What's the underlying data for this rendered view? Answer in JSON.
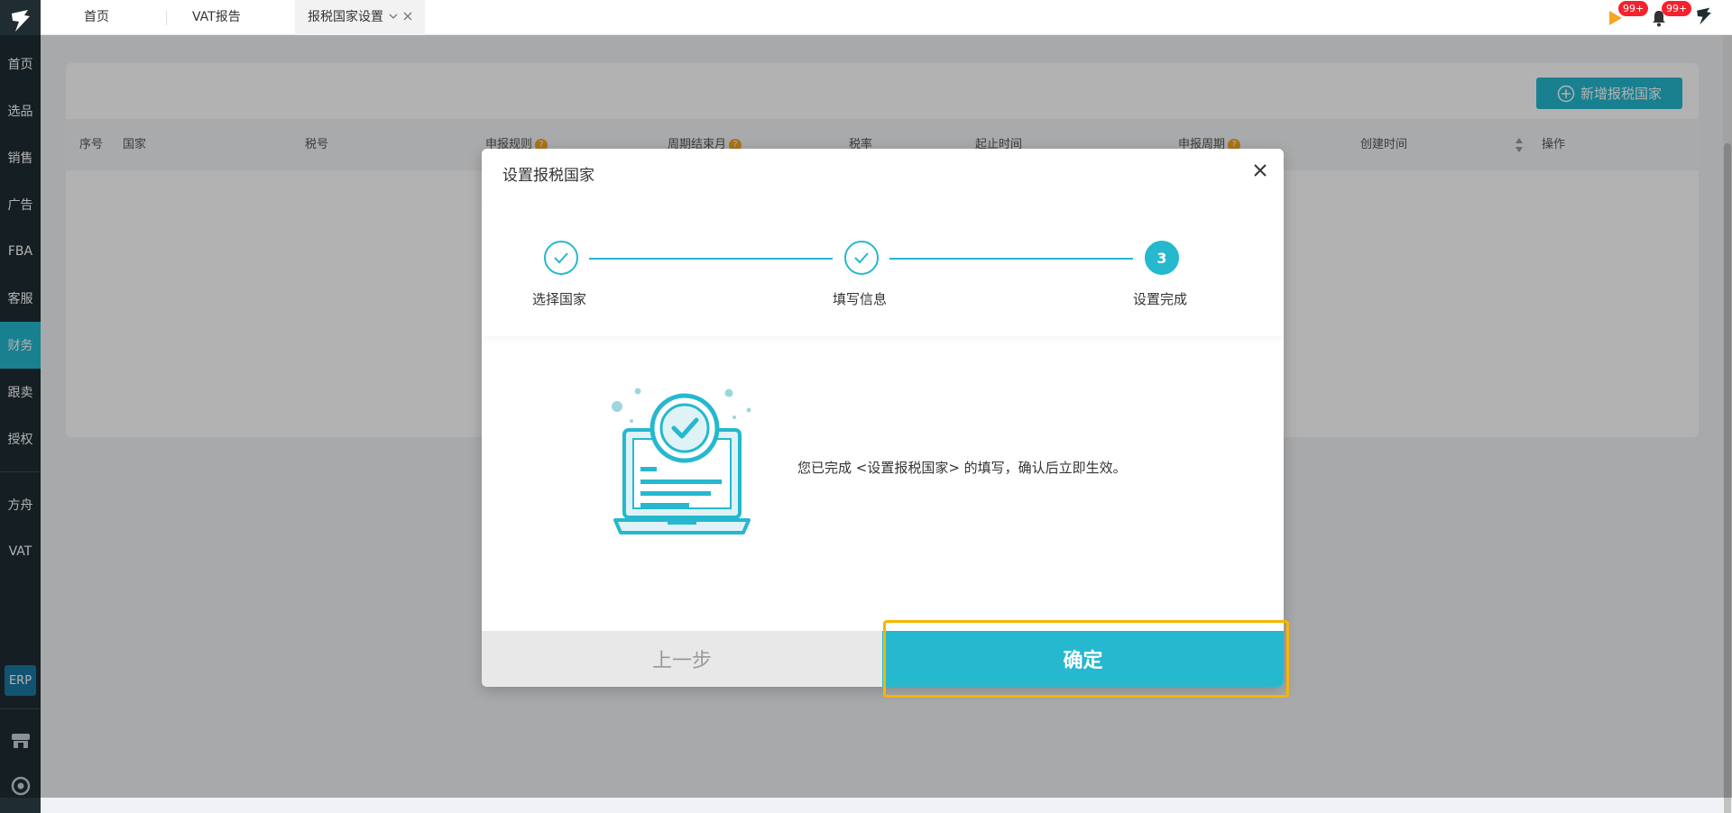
{
  "sidebar": {
    "items": [
      {
        "label": "首页"
      },
      {
        "label": "选品"
      },
      {
        "label": "销售"
      },
      {
        "label": "广告"
      },
      {
        "label": "FBA"
      },
      {
        "label": "客服"
      },
      {
        "label": "财务"
      },
      {
        "label": "跟卖"
      },
      {
        "label": "授权"
      }
    ],
    "items2": [
      {
        "label": "方舟"
      },
      {
        "label": "VAT"
      }
    ],
    "erp_label": "ERP"
  },
  "tabs": [
    {
      "label": "首页"
    },
    {
      "label": "VAT报告"
    },
    {
      "label": "报税国家设置"
    }
  ],
  "header": {
    "badge1": "99+",
    "badge2": "99+"
  },
  "page": {
    "add_button_label": "新增报税国家",
    "columns": [
      {
        "label": "序号"
      },
      {
        "label": "国家"
      },
      {
        "label": "税号"
      },
      {
        "label": "申报规则"
      },
      {
        "label": "周期结束月"
      },
      {
        "label": "税率"
      },
      {
        "label": "起止时间"
      },
      {
        "label": "申报周期"
      },
      {
        "label": "创建时间"
      },
      {
        "label": "操作"
      }
    ]
  },
  "modal": {
    "title": "设置报税国家",
    "steps": [
      {
        "label": "选择国家"
      },
      {
        "label": "填写信息"
      },
      {
        "label": "设置完成",
        "number": "3"
      }
    ],
    "message": "您已完成 <设置报税国家> 的填写，确认后立即生效。",
    "prev_label": "上一步",
    "confirm_label": "确定"
  },
  "colors": {
    "accent": "#25b8cf",
    "highlight": "#f7b500"
  }
}
